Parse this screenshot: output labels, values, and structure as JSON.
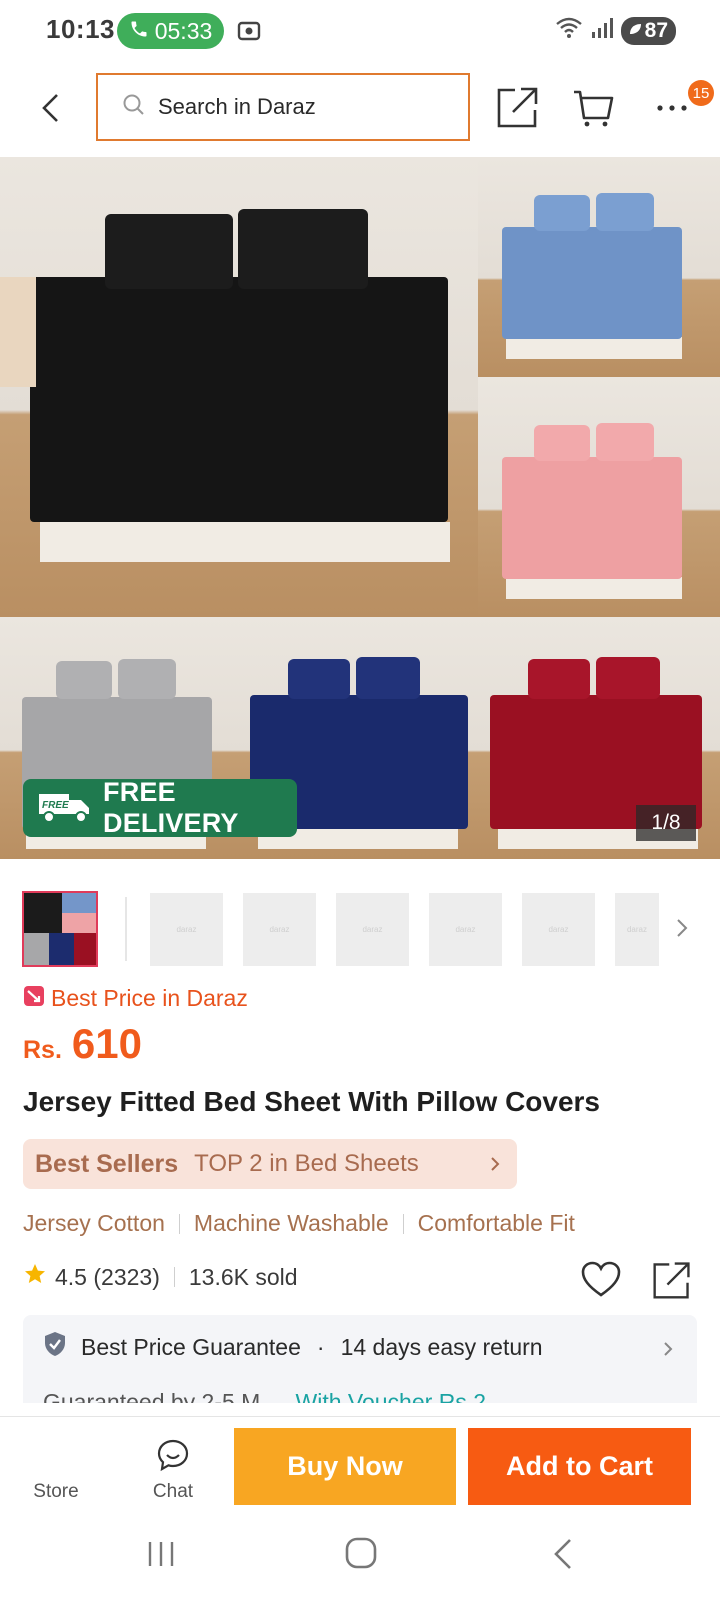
{
  "status_bar": {
    "time": "10:13",
    "call_timer": "05:33",
    "battery": "87"
  },
  "header": {
    "search_placeholder": "Search in Daraz",
    "cart_badge": "15"
  },
  "gallery": {
    "free_delivery_badge": "FREE DELIVERY",
    "free_icon_label": "FREE",
    "counter": "1/8",
    "colors": [
      "#151515",
      "#6f93c7",
      "#eea0a2",
      "#a6a6a8",
      "#1a2a6c",
      "#9a1022"
    ]
  },
  "thumbnails": {
    "placeholder_text": "daraz",
    "count_visible": 6
  },
  "price": {
    "best_price_label": "Best Price in Daraz",
    "currency": "Rs.",
    "value": "610"
  },
  "product": {
    "title": "Jersey Fitted Bed Sheet With Pillow Covers",
    "best_sellers_brand": "Best Sellers",
    "best_sellers_rank": "TOP 2 in Bed Sheets",
    "features": [
      "Jersey Cotton",
      "Machine Washable",
      "Comfortable Fit"
    ],
    "rating": "4.5 (2323)",
    "sold": "13.6K sold"
  },
  "service": {
    "guarantee": "Best Price Guarantee",
    "returns": "14 days easy return",
    "partial_left": "Guaranteed by 2-5 M...",
    "partial_right": "With Voucher Rs.2..."
  },
  "action_bar": {
    "store_label": "Store",
    "chat_label": "Chat",
    "buy_now": "Buy Now",
    "add_to_cart": "Add to Cart"
  },
  "colors": {
    "brand_orange": "#f75b12",
    "buy_yellow": "#f8a622",
    "delivery_green": "#1f7a4f",
    "price_orange": "#f05b1c"
  }
}
